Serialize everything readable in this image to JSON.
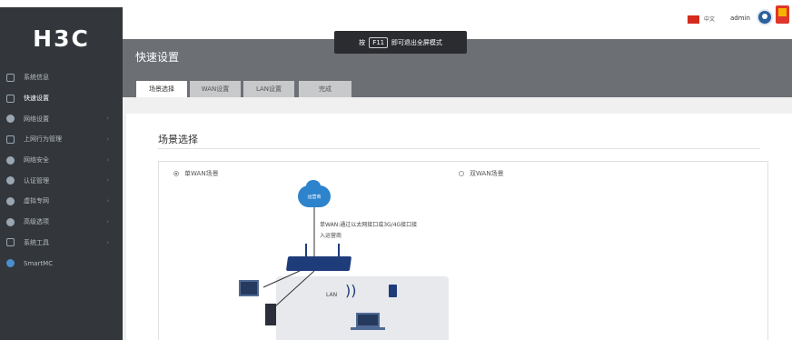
{
  "app": {
    "logo": "H3C"
  },
  "topbar": {
    "language": "中文",
    "user": "admin"
  },
  "sidebar": {
    "items": [
      {
        "label": "系统信息",
        "has_arrow": false,
        "active": false
      },
      {
        "label": "快速设置",
        "has_arrow": false,
        "active": true
      },
      {
        "label": "网络设置",
        "has_arrow": true,
        "active": false
      },
      {
        "label": "上网行为管理",
        "has_arrow": true,
        "active": false
      },
      {
        "label": "网络安全",
        "has_arrow": true,
        "active": false
      },
      {
        "label": "认证管理",
        "has_arrow": true,
        "active": false
      },
      {
        "label": "虚拟专网",
        "has_arrow": true,
        "active": false
      },
      {
        "label": "高级选项",
        "has_arrow": true,
        "active": false
      },
      {
        "label": "系统工具",
        "has_arrow": true,
        "active": false
      },
      {
        "label": "SmartMC",
        "has_arrow": false,
        "active": false
      }
    ]
  },
  "header": {
    "title": "快速设置"
  },
  "tip": {
    "prefix": "按",
    "key": "F11",
    "suffix": "即可退出全屏模式"
  },
  "tabs": [
    {
      "label": "场景选择",
      "active": true
    },
    {
      "label": "WAN设置",
      "active": false
    },
    {
      "label": "LAN设置",
      "active": false
    },
    {
      "label": "完成",
      "active": false
    }
  ],
  "main": {
    "section_title": "场景选择",
    "options": [
      {
        "label": "单WAN场景",
        "checked": true
      },
      {
        "label": "双WAN场景",
        "checked": false
      }
    ],
    "diagram": {
      "cloud_label": "运营商",
      "wan_note": "单WAN:通过以太网接口或3G/4G接口接入运营商",
      "lan_label": "LAN"
    }
  },
  "colors": {
    "sidebar_bg": "#33373b",
    "banner_bg": "#6c6f74",
    "accent_blue": "#2d83cc",
    "router_blue": "#1f3c7a"
  }
}
